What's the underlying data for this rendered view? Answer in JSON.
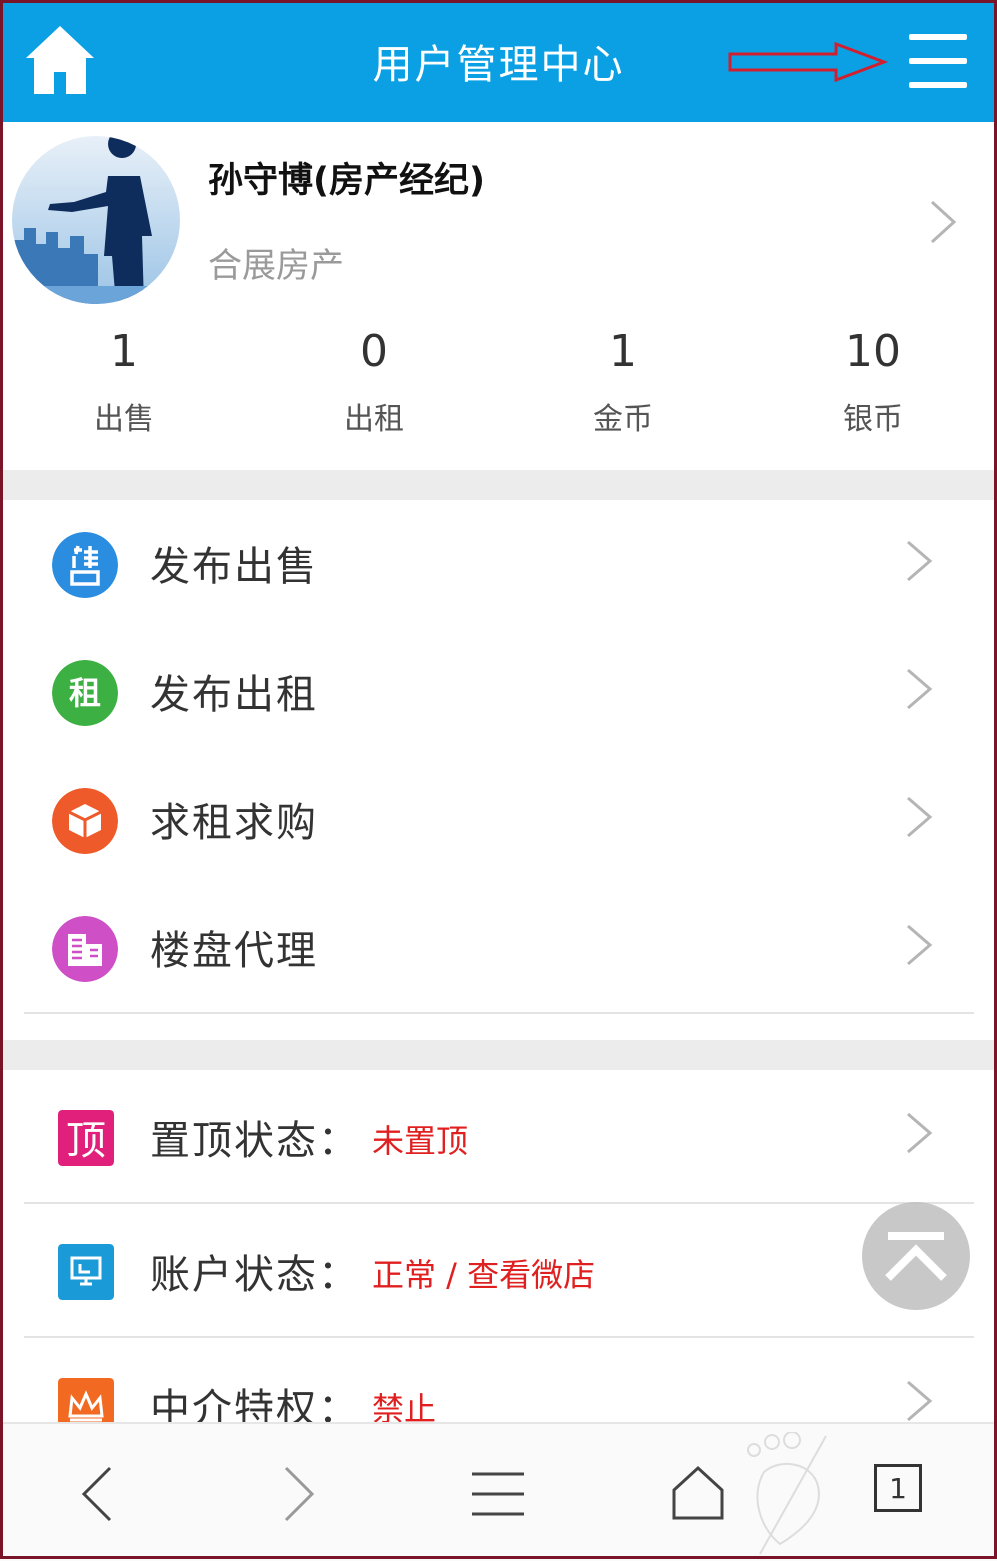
{
  "header": {
    "title": "用户管理中心"
  },
  "profile": {
    "name": "孙守博(房产经纪)",
    "company": "合展房产",
    "stats": [
      {
        "value": "1",
        "label": "出售"
      },
      {
        "value": "0",
        "label": "出租"
      },
      {
        "value": "1",
        "label": "金币"
      },
      {
        "value": "10",
        "label": "银币"
      }
    ]
  },
  "menu": {
    "items": [
      {
        "label": "发布出售",
        "icon": "sale-icon",
        "color": "#2b8de0"
      },
      {
        "label": "发布出租",
        "icon": "rent-icon",
        "color": "#3cb043"
      },
      {
        "label": "求租求购",
        "icon": "box-icon",
        "color": "#ee5a2a"
      },
      {
        "label": "楼盘代理",
        "icon": "building-icon",
        "color": "#cf4fc6"
      }
    ]
  },
  "status": {
    "items": [
      {
        "label": "置顶状态：",
        "value": "未置顶",
        "icon": "top-icon",
        "color": "#e0207a"
      },
      {
        "label": "账户状态：",
        "value": "正常 / 查看微店",
        "icon": "monitor-icon",
        "color": "#1a9ad6"
      },
      {
        "label": "中介特权：",
        "value": "禁止",
        "icon": "crown-icon",
        "color": "#f26a22"
      }
    ]
  },
  "bottom_nav": {
    "tab_count": "1"
  },
  "icons": {
    "top_glyph": "顶",
    "rent_glyph": "租"
  },
  "colors": {
    "header": "#0aa0e3",
    "status_value": "#e02020"
  }
}
